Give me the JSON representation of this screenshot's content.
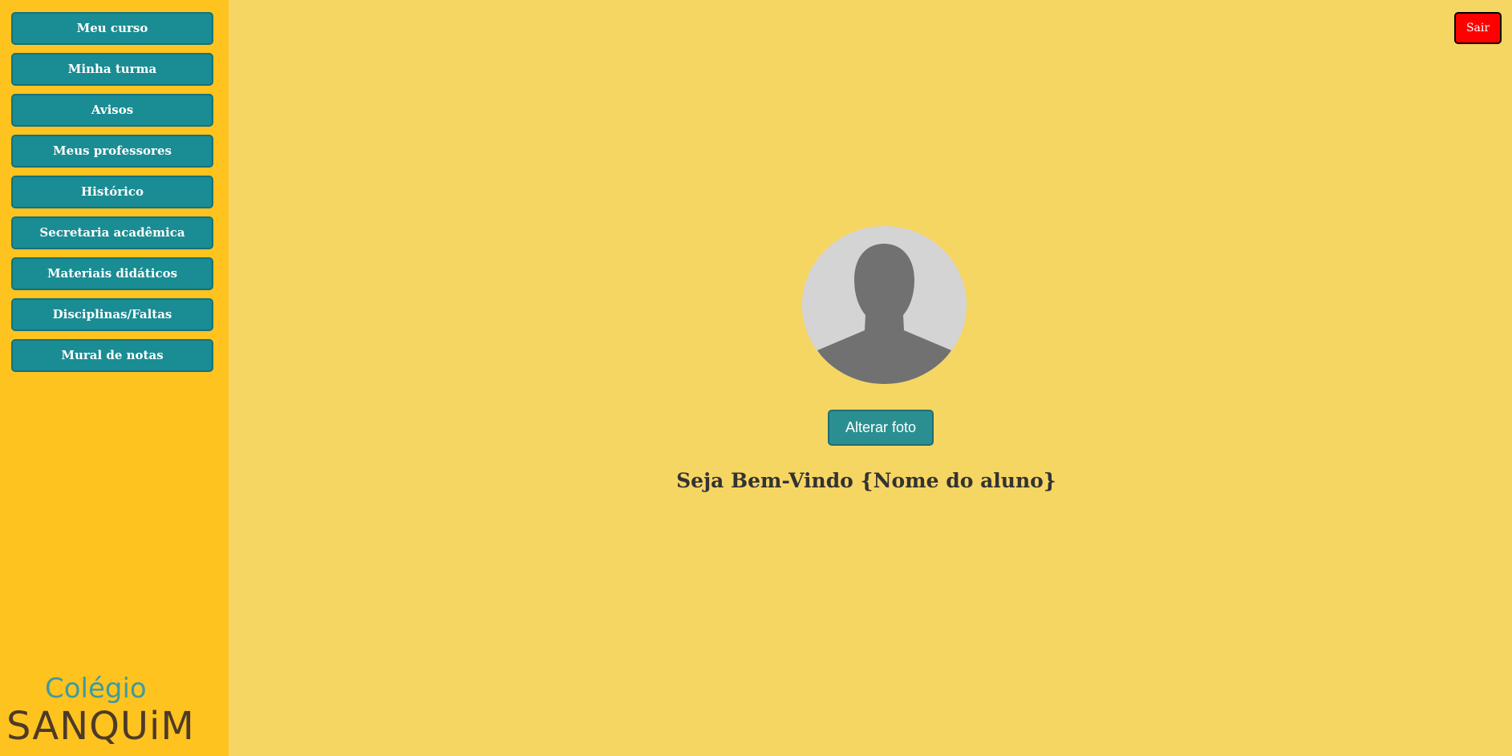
{
  "sidebar": {
    "items": [
      {
        "label": "Meu curso"
      },
      {
        "label": "Minha turma"
      },
      {
        "label": "Avisos"
      },
      {
        "label": "Meus professores"
      },
      {
        "label": "Histórico"
      },
      {
        "label": "Secretaria acadêmica"
      },
      {
        "label": "Materiais didáticos"
      },
      {
        "label": "Disciplinas/Faltas"
      },
      {
        "label": "Mural de notas"
      }
    ],
    "logo": {
      "top": "Colégio",
      "bottom": "SANQUiM"
    }
  },
  "header": {
    "logout_label": "Sair"
  },
  "main": {
    "avatar_icon": "person-placeholder-icon",
    "change_photo_label": "Alterar foto",
    "welcome_text": "Seja Bem-Vindo {Nome do aluno}"
  },
  "colors": {
    "page_background": "#f6d662",
    "sidebar_background": "#ffc31f",
    "menu_button": "#1a8c93",
    "logout_button": "#ff0000",
    "logo_teal": "#3f9aa0",
    "logo_brown": "#4e3a28"
  }
}
